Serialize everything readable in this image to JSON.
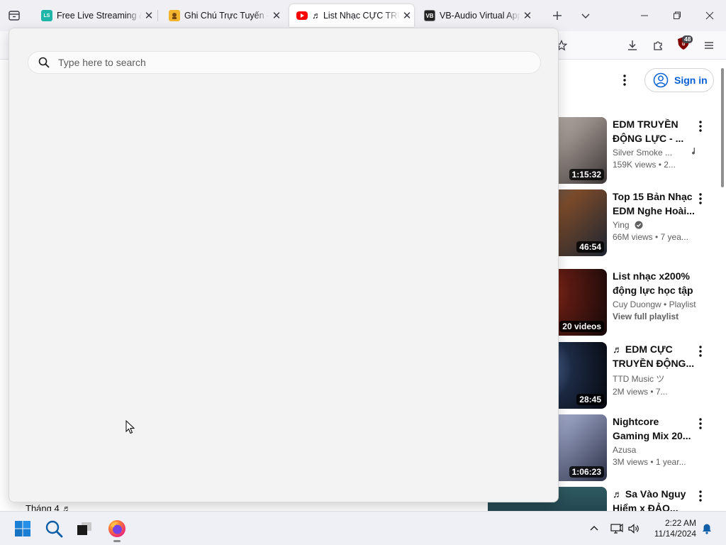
{
  "browser": {
    "tabs": [
      {
        "title": "Free Live Streaming & P",
        "favicon_color": "#1fb5a8",
        "favicon_text": "LS",
        "active": false
      },
      {
        "title": "Ghi Chú Trực Tuyến - S",
        "favicon_color": "#f3b42e",
        "favicon_text": "",
        "active": false
      },
      {
        "title": "♬ List Nhạc CỰC TRUY",
        "favicon_color": "#ff0000",
        "favicon_text": "",
        "active": true
      },
      {
        "title": "VB-Audio Virtual Apps",
        "favicon_color": "#222222",
        "favicon_text": "VB",
        "active": false
      }
    ],
    "extension_badge": "48"
  },
  "search": {
    "placeholder": "Type here to search"
  },
  "youtube": {
    "sign_in_label": "Sign in",
    "recommendations": [
      {
        "title": "EDM TRUYỀN ĐỘNG LỰC - ...",
        "channel": "Silver Smoke ...",
        "stats": "159K views  •  2...",
        "duration": "1:15:32",
        "has_music_note": true,
        "thumb": [
          "#c9c3bf",
          "#8d8480",
          "#3b3636"
        ]
      },
      {
        "title": "Top 15 Bản Nhạc EDM Nghe Hoài...",
        "channel": "Ying",
        "stats": "66M views  •  7 yea...",
        "duration": "46:54",
        "verified": true,
        "thumb": [
          "#2f4a6e",
          "#7a4a2a",
          "#1c2532"
        ]
      },
      {
        "title": "List nhạc x200% động lực học tập",
        "channel": "Cuy Duongw • Playlist",
        "extra": "View full playlist",
        "duration": "20 videos",
        "thumb": [
          "#5a1a12",
          "#b8391c",
          "#140808"
        ]
      },
      {
        "title": "♬ EDM CỰC TRUYỀN ĐỘNG...",
        "channel": "TTD Music ツ",
        "stats": "2M views  •  7...",
        "duration": "28:45",
        "thumb": [
          "#0c1424",
          "#4a6a9a",
          "#05070c"
        ]
      },
      {
        "title": "Nightcore Gaming Mix 20...",
        "channel": "Azusa",
        "stats": "3M views  •  1 year...",
        "duration": "1:06:23",
        "thumb": [
          "#b9c3d6",
          "#7e86a8",
          "#2a2f44"
        ]
      },
      {
        "title": "♬ Sa Vào Nguy Hiểm x ĐẢO...",
        "channel": "",
        "stats": "",
        "duration": "",
        "thumb": [
          "#1c3a44",
          "#3f6e70",
          "#0d1a1e"
        ]
      }
    ]
  },
  "left_page": {
    "visible_text": "Tháng 4 ♬"
  },
  "taskbar": {
    "time": "2:22 AM",
    "date": "11/14/2024"
  }
}
